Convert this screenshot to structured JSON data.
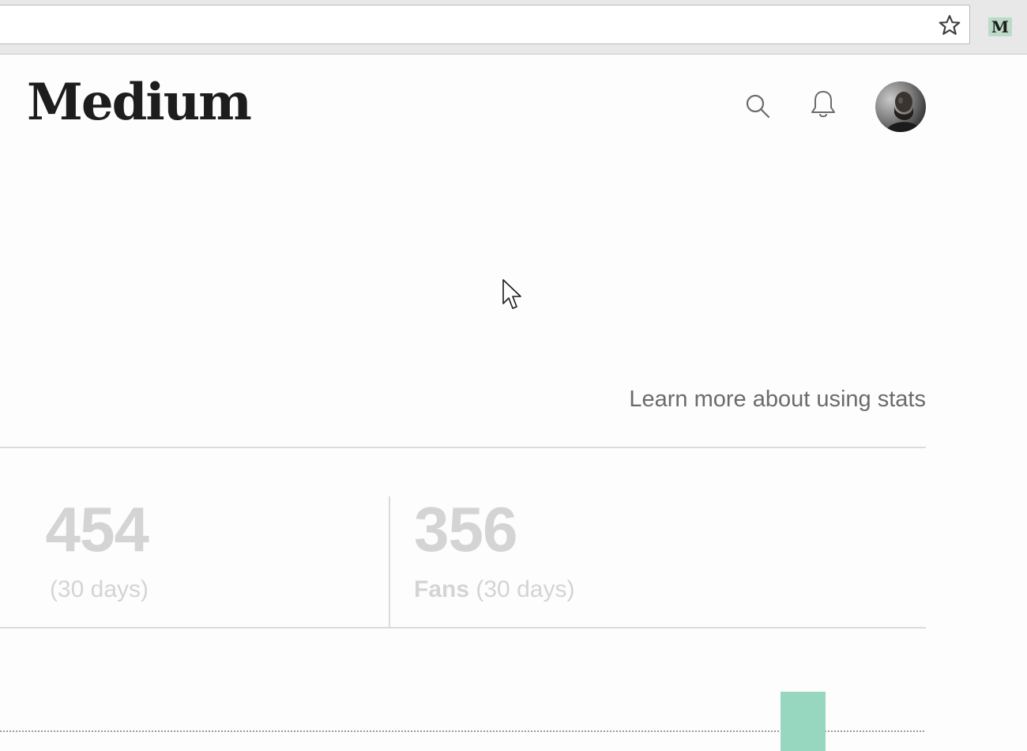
{
  "extension": {
    "label": "M",
    "accent": "#6cc08b"
  },
  "header": {
    "logo_text": "Medium",
    "icons": [
      "search-icon",
      "bell-icon"
    ]
  },
  "stats": {
    "learn_link": "Learn more about using stats",
    "cards": [
      {
        "number": "454",
        "label_bold": "",
        "label_rest": "(30 days)"
      },
      {
        "number": "356",
        "label_bold": "Fans",
        "label_rest": "(30 days)"
      }
    ],
    "bar_color": "#97d6bf",
    "bar_level": 0.86
  }
}
